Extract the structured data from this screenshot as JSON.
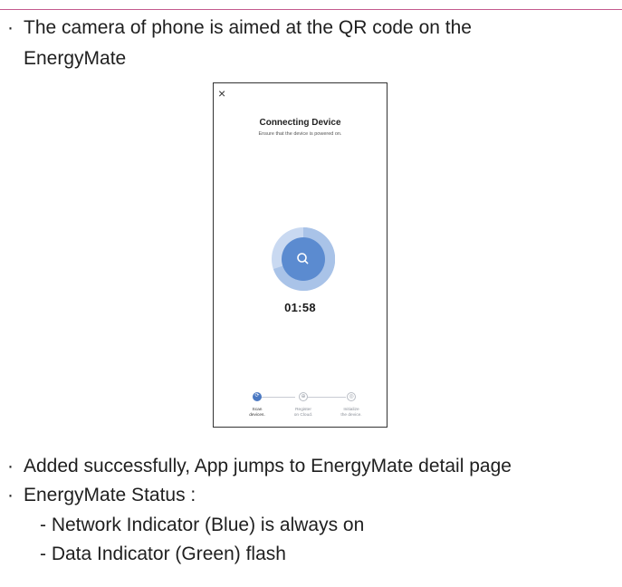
{
  "bullets": [
    {
      "marker": "·",
      "line1": "The camera of phone is aimed at the QR code on the",
      "line2": "EnergyMate"
    },
    {
      "marker": "·",
      "text": "Added successfully, App jumps to EnergyMate detail page"
    },
    {
      "marker": "·",
      "text": "EnergyMate Status :"
    }
  ],
  "sub_items": [
    "-  Network Indicator (Blue) is always on",
    "-  Data Indicator (Green) flash"
  ],
  "phone": {
    "close_glyph": "×",
    "title": "Connecting Device",
    "subtitle": "Ensure that the device is powered on.",
    "timer": "01:58",
    "steps": [
      {
        "label_line1": "Scan",
        "label_line2": "devices.",
        "glyph": "⟳",
        "state": "active"
      },
      {
        "label_line1": "Register",
        "label_line2": "on Cloud.",
        "glyph": "⊕",
        "state": "pending"
      },
      {
        "label_line1": "Initialize",
        "label_line2": "the device.",
        "glyph": "◎",
        "state": "pending"
      }
    ]
  },
  "colors": {
    "accent_rule": "#c45a8e",
    "progress_outer": "#a9c3e8",
    "progress_inner": "#5b8bd0",
    "step_active": "#4a78c2"
  }
}
